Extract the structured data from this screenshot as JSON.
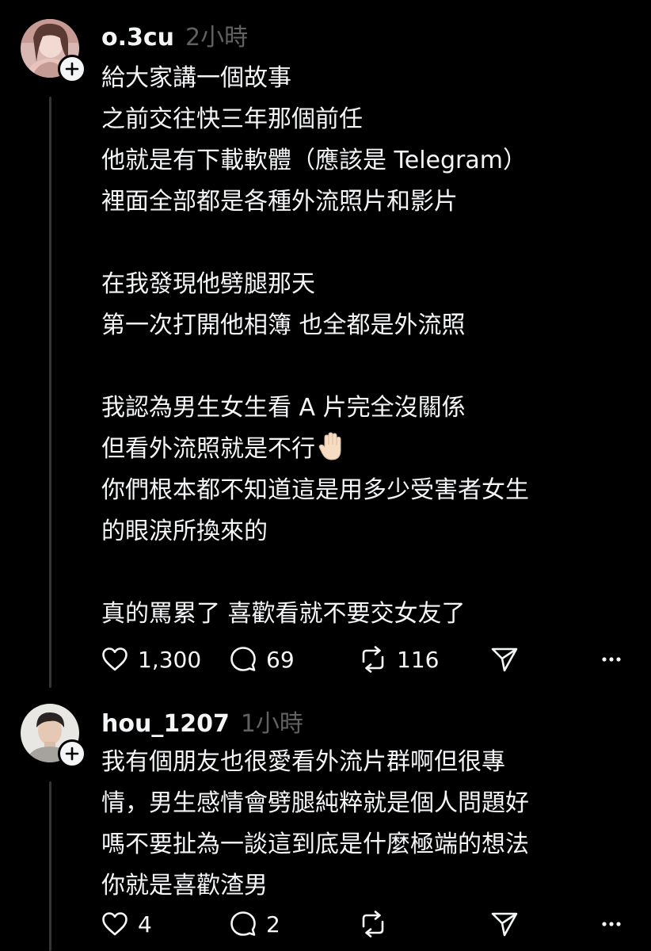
{
  "posts": [
    {
      "username": "o.3cu",
      "time": "2小時",
      "lines": [
        "給大家講一個故事",
        "之前交往快三年那個前任",
        "他就是有下載軟體（應該是 Telegram）",
        "裡面全部都是各種外流照片和影片",
        "",
        "在我發現他劈腿那天",
        "第一次打開他相簿 也全都是外流照",
        "",
        "我認為男生女生看 A 片完全沒關係",
        "但看外流照就是不行",
        "你們根本都不知道這是用多少受害者女生",
        "的眼淚所換來的",
        "",
        "真的罵累了 喜歡看就不要交女友了"
      ],
      "emoji_after_line": 9,
      "emoji": "raised-hand-icon",
      "likes": "1,300",
      "comments": "69",
      "reposts": "116"
    },
    {
      "username": "hou_1207",
      "time": "1小時",
      "lines": [
        "我有個朋友也很愛看外流片群啊但很專",
        "情，男生感情會劈腿純粹就是個人問題好",
        "嗎不要扯為一談這到底是什麼極端的想法",
        "你就是喜歡渣男"
      ],
      "likes": "4",
      "comments": "2",
      "reposts": ""
    }
  ],
  "colors": {
    "background": "#000000",
    "text": "#f3f5f7",
    "muted": "#616161",
    "thread_line": "#333638"
  }
}
